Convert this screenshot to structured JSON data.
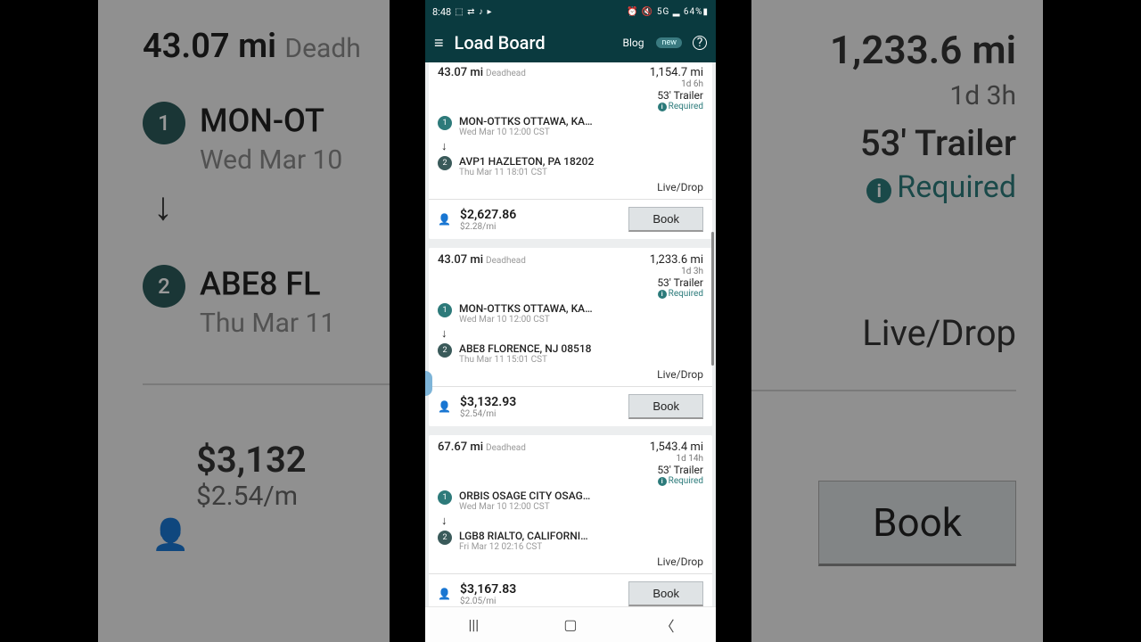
{
  "statusbar": {
    "time": "8:48",
    "icons_left": "⬚ ⇄ ♪ ▸",
    "icons_right": "⏰ 🔇 5G ▂ 64%▮"
  },
  "appbar": {
    "title": "Load Board",
    "blog": "Blog",
    "new": "new",
    "help": "?"
  },
  "bg_left": {
    "deadhead_val": "43.07 mi",
    "deadhead_lbl": "Deadh",
    "stop1": "MON-OT",
    "stop1date": "Wed Mar 10",
    "stop2": "ABE8 FL",
    "stop2date": "Thu Mar 11",
    "price": "$3,132",
    "permi": "$2.54/m"
  },
  "bg_right": {
    "distance": "1,233.6 mi",
    "duration": "1d 3h",
    "trailer": "53' Trailer",
    "required": "Required",
    "livedrop": "Live/Drop",
    "book": "Book"
  },
  "loads": [
    {
      "deadhead": "43.07 mi",
      "deadhead_lbl": "Deadhead",
      "distance": "1,154.7 mi",
      "duration": "1d 6h",
      "trailer": "53' Trailer",
      "required": "Required",
      "pickup": "MON-OTTKS OTTAWA, KA…",
      "pickup_date": "Wed Mar 10 12:00 CST",
      "drop": "AVP1 HAZLETON, PA 18202",
      "drop_date": "Thu Mar 11 18:01 CST",
      "livedrop": "Live/Drop",
      "price": "$2,627.86",
      "permi": "$2.28/mi",
      "book": "Book"
    },
    {
      "deadhead": "43.07 mi",
      "deadhead_lbl": "Deadhead",
      "distance": "1,233.6 mi",
      "duration": "1d 3h",
      "trailer": "53' Trailer",
      "required": "Required",
      "pickup": "MON-OTTKS OTTAWA, KA…",
      "pickup_date": "Wed Mar 10 12:00 CST",
      "drop": "ABE8 FLORENCE, NJ 08518",
      "drop_date": "Thu Mar 11 15:01 CST",
      "livedrop": "Live/Drop",
      "price": "$3,132.93",
      "permi": "$2.54/mi",
      "book": "Book"
    },
    {
      "deadhead": "67.67 mi",
      "deadhead_lbl": "Deadhead",
      "distance": "1,543.4 mi",
      "duration": "1d 14h",
      "trailer": "53' Trailer",
      "required": "Required",
      "pickup": "ORBIS OSAGE CITY OSAG…",
      "pickup_date": "Wed Mar 10 12:00 CST",
      "drop": "LGB8 RIALTO, CALIFORNI…",
      "drop_date": "Fri Mar 12 02:16 CST",
      "livedrop": "Live/Drop",
      "price": "$3,167.83",
      "permi": "$2.05/mi",
      "book": "Book"
    }
  ]
}
